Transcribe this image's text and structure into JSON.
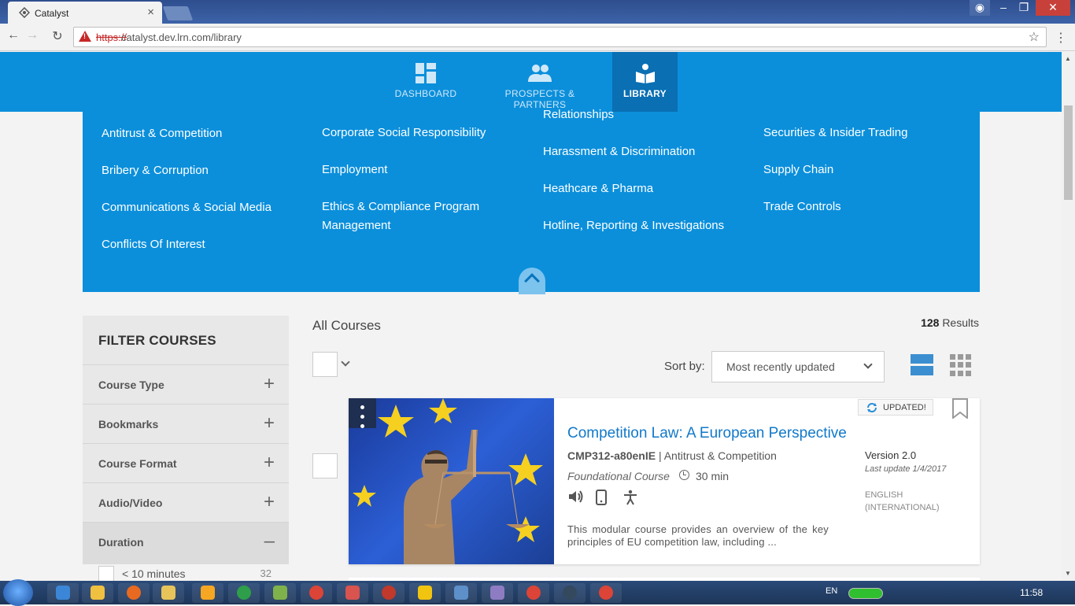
{
  "browser": {
    "tab_title": "Catalyst",
    "url_scheme": "https://",
    "url_rest": "catalyst.dev.lrn.com/library"
  },
  "nav": {
    "items": [
      {
        "label": "DASHBOARD",
        "icon": "dashboard-icon"
      },
      {
        "label": "PROSPECTS & PARTNERS",
        "icon": "people-icon"
      },
      {
        "label": "LIBRARY",
        "icon": "library-book-icon",
        "active": true
      }
    ]
  },
  "categories": {
    "col1": [
      "Antitrust & Competition",
      "Bribery & Corruption",
      "Communications & Social Media",
      "Conflicts Of Interest"
    ],
    "col2": [
      "Corporate Social Responsibility",
      "Employment",
      "Ethics & Compliance Program Management"
    ],
    "col3": [
      "Relationships",
      "Harassment & Discrimination",
      "Heathcare & Pharma",
      "Hotline, Reporting & Investigations"
    ],
    "col4": [
      "Securities & Insider Trading",
      "Supply Chain",
      "Trade Controls"
    ]
  },
  "filter": {
    "heading": "FILTER COURSES",
    "sections": [
      {
        "label": "Course Type",
        "state": "+"
      },
      {
        "label": "Bookmarks",
        "state": "+"
      },
      {
        "label": "Course Format",
        "state": "+"
      },
      {
        "label": "Audio/Video",
        "state": "+"
      },
      {
        "label": "Duration",
        "state": "–"
      }
    ],
    "duration_options": [
      {
        "label": "< 10 minutes",
        "count": "32"
      }
    ]
  },
  "list": {
    "heading": "All Courses",
    "results_count": "128",
    "results_label": "Results",
    "sort_label": "Sort by:",
    "sort_value": "Most recently updated"
  },
  "course": {
    "badge": "UPDATED!",
    "title": "Competition Law: A European Perspective",
    "code": "CMP312-a80enIE",
    "category": "| Antitrust & Competition",
    "type": "Foundational Course",
    "duration": "30 min",
    "description": "This modular course provides an overview of the key principles of EU competition law, including ...",
    "version": "Version 2.0",
    "last_update": "Last update 1/4/2017",
    "language": "ENGLISH (INTERNATIONAL)"
  },
  "taskbar": {
    "lang": "EN",
    "time": "11:58"
  },
  "colors": {
    "brand_blue": "#0b8fdb",
    "active_nav": "#0a6fb3",
    "link_blue": "#1179c9"
  }
}
